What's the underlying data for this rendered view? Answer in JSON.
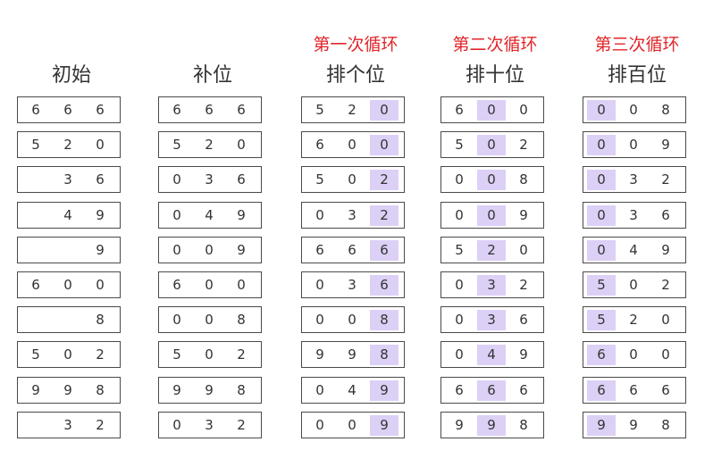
{
  "highlight_color": "#ddd0f6",
  "round_color": "#e0262a",
  "columns": [
    {
      "key": "initial",
      "round": "",
      "title": "初始",
      "highlight_digit": -1,
      "rows": [
        [
          "6",
          "6",
          "6"
        ],
        [
          "5",
          "2",
          "0"
        ],
        [
          "",
          "3",
          "6"
        ],
        [
          "",
          "4",
          "9"
        ],
        [
          "",
          "",
          "9"
        ],
        [
          "6",
          "0",
          "0"
        ],
        [
          "",
          "",
          "8"
        ],
        [
          "5",
          "0",
          "2"
        ],
        [
          "9",
          "9",
          "8"
        ],
        [
          "",
          "3",
          "2"
        ]
      ]
    },
    {
      "key": "padded",
      "round": "",
      "title": "补位",
      "highlight_digit": -1,
      "rows": [
        [
          "6",
          "6",
          "6"
        ],
        [
          "5",
          "2",
          "0"
        ],
        [
          "0",
          "3",
          "6"
        ],
        [
          "0",
          "4",
          "9"
        ],
        [
          "0",
          "0",
          "9"
        ],
        [
          "6",
          "0",
          "0"
        ],
        [
          "0",
          "0",
          "8"
        ],
        [
          "5",
          "0",
          "2"
        ],
        [
          "9",
          "9",
          "8"
        ],
        [
          "0",
          "3",
          "2"
        ]
      ]
    },
    {
      "key": "ones",
      "round": "第一次循环",
      "title": "排个位",
      "highlight_digit": 2,
      "rows": [
        [
          "5",
          "2",
          "0"
        ],
        [
          "6",
          "0",
          "0"
        ],
        [
          "5",
          "0",
          "2"
        ],
        [
          "0",
          "3",
          "2"
        ],
        [
          "6",
          "6",
          "6"
        ],
        [
          "0",
          "3",
          "6"
        ],
        [
          "0",
          "0",
          "8"
        ],
        [
          "9",
          "9",
          "8"
        ],
        [
          "0",
          "4",
          "9"
        ],
        [
          "0",
          "0",
          "9"
        ]
      ]
    },
    {
      "key": "tens",
      "round": "第二次循环",
      "title": "排十位",
      "highlight_digit": 1,
      "rows": [
        [
          "6",
          "0",
          "0"
        ],
        [
          "5",
          "0",
          "2"
        ],
        [
          "0",
          "0",
          "8"
        ],
        [
          "0",
          "0",
          "9"
        ],
        [
          "5",
          "2",
          "0"
        ],
        [
          "0",
          "3",
          "2"
        ],
        [
          "0",
          "3",
          "6"
        ],
        [
          "0",
          "4",
          "9"
        ],
        [
          "6",
          "6",
          "6"
        ],
        [
          "9",
          "9",
          "8"
        ]
      ]
    },
    {
      "key": "hundreds",
      "round": "第三次循环",
      "title": "排百位",
      "highlight_digit": 0,
      "rows": [
        [
          "0",
          "0",
          "8"
        ],
        [
          "0",
          "0",
          "9"
        ],
        [
          "0",
          "3",
          "2"
        ],
        [
          "0",
          "3",
          "6"
        ],
        [
          "0",
          "4",
          "9"
        ],
        [
          "5",
          "0",
          "2"
        ],
        [
          "5",
          "2",
          "0"
        ],
        [
          "6",
          "0",
          "0"
        ],
        [
          "6",
          "6",
          "6"
        ],
        [
          "9",
          "9",
          "8"
        ]
      ]
    }
  ]
}
